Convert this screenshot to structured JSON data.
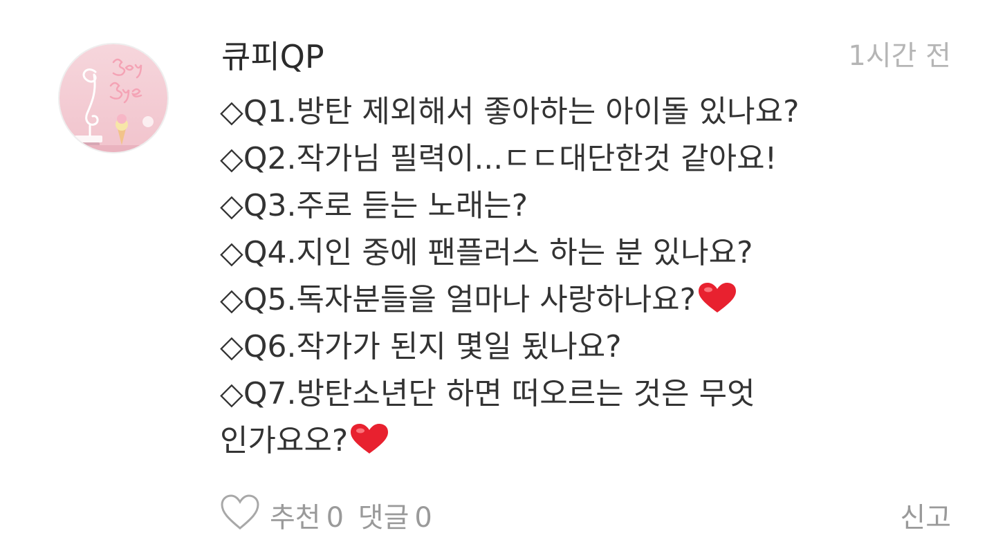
{
  "post": {
    "author": "큐피QP",
    "time": "1시간 전",
    "avatar_icon": "profile-avatar-flamingo",
    "lines": [
      "◇Q1.방탄 제외해서 좋아하는 아이돌 있나요?",
      "◇Q2.작가님 필력이...ㄷㄷ대단한것 같아요!",
      "◇Q3.주로 듣는 노래는?",
      "◇Q4.지인 중에 팬플러스 하는 분 있나요?",
      "◇Q5.독자분들을 얼마나 사랑하나요?",
      "◇Q6.작가가 된지 몇일 됬나요?",
      "◇Q7.방탄소년단 하면 떠오르는 것은 무엇",
      "인가요오?"
    ],
    "heart_color": "#e8212f"
  },
  "footer": {
    "like_icon": "heart-outline-icon",
    "recommend_label": "추천",
    "recommend_count": "0",
    "comment_label": "댓글",
    "comment_count": "0",
    "report_label": "신고"
  }
}
